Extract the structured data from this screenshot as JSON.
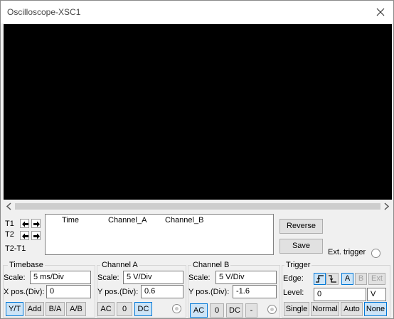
{
  "window": {
    "title": "Oscilloscope-XSC1"
  },
  "cursors": {
    "t1": "T1",
    "t2": "T2",
    "diff": "T2-T1"
  },
  "readout": {
    "columns": [
      "Time",
      "Channel_A",
      "Channel_B"
    ]
  },
  "actions": {
    "reverse": "Reverse",
    "save": "Save",
    "ext_trigger": "Ext. trigger"
  },
  "timebase": {
    "title": "Timebase",
    "scale_label": "Scale:",
    "scale_value": "5 ms/Div",
    "xpos_label": "X pos.(Div):",
    "xpos_value": "0",
    "modes": [
      "Y/T",
      "Add",
      "B/A",
      "A/B"
    ],
    "active_mode": "Y/T"
  },
  "channel_a": {
    "title": "Channel A",
    "scale_label": "Scale:",
    "scale_value": "5  V/Div",
    "ypos_label": "Y pos.(Div):",
    "ypos_value": "0.6",
    "coupling": [
      "AC",
      "0",
      "DC"
    ],
    "active_coupling": "DC"
  },
  "channel_b": {
    "title": "Channel B",
    "scale_label": "Scale:",
    "scale_value": "5  V/Div",
    "ypos_label": "Y pos.(Div):",
    "ypos_value": "-1.6",
    "coupling": [
      "AC",
      "0",
      "DC",
      "-"
    ],
    "active_coupling": "AC"
  },
  "trigger": {
    "title": "Trigger",
    "edge_label": "Edge:",
    "sources": [
      "A",
      "B",
      "Ext"
    ],
    "active_source": "A",
    "level_label": "Level:",
    "level_value": "0",
    "level_unit": "V",
    "modes": [
      "Single",
      "Normal",
      "Auto",
      "None"
    ],
    "active_mode": "None"
  }
}
